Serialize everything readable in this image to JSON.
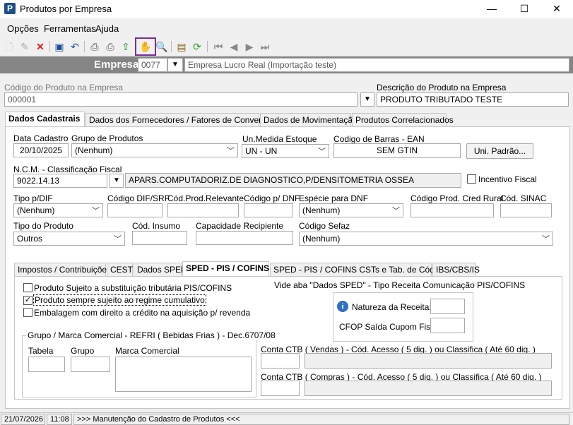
{
  "window": {
    "title": "Produtos por Empresa",
    "minimize": "—",
    "maximize": "☐",
    "close": "✕"
  },
  "menu": {
    "opcoes": "Opções",
    "ferramentas": "Ferramentas",
    "ajuda": "Ajuda"
  },
  "empresa": {
    "label": "Empresa",
    "code": "0077",
    "name": "Empresa Lucro Real (Importação teste)"
  },
  "header": {
    "codigo_label": "Código do Produto na Empresa",
    "codigo_value": "000001",
    "descricao_label": "Descrição do Produto na Empresa",
    "descricao_value": "PRODUTO TRIBUTADO TESTE"
  },
  "tabs": [
    "Dados Cadastrais",
    "Dados dos Fornecedores / Fatores de Conversão",
    "Dados de Movimentação",
    "Produtos Correlacionados"
  ],
  "form": {
    "data_cadastro_label": "Data Cadastro",
    "data_cadastro": "20/10/2025",
    "grupo_label": "Grupo de Produtos",
    "grupo": "(Nenhum)",
    "unmedida_label": "Un.Medida Estoque",
    "unmedida": "UN - UN",
    "ean_label": "Codigo de Barras - EAN",
    "ean": "SEM GTIN",
    "uni_padrao_btn": "Uni. Padrão...",
    "ncm_label": "N.C.M. -  Classificação Fiscal",
    "ncm": "9022.14.13",
    "ncm_desc": "APARS.COMPUTADORIZ.DE DIAGNOSTICO,P/DENSITOMETRIA OSSEA",
    "incentivo_label": "Incentivo Fiscal",
    "tipo_dif_label": "Tipo p/DIF",
    "tipo_dif": "(Nenhum)",
    "codigo_dif_label": "Código DIF/SRF",
    "cod_relevante_label": "Cód.Prod.Relevante",
    "codigo_dnf_label": "Código p/ DNF",
    "especie_dnf_label": "Espécie para DNF",
    "especie_dnf": "(Nenhum)",
    "cred_rural_label": "Código Prod. Cred Rural",
    "sinac_label": "Cód. SINAC",
    "tipo_produto_label": "Tipo do Produto",
    "tipo_produto": "Outros",
    "insumo_label": "Cód. Insumo",
    "capacidade_label": "Capacidade Recipiente",
    "sefaz_label": "Código Sefaz",
    "sefaz": "(Nenhum)"
  },
  "subtabs": [
    "Impostos / Contribuições",
    "CEST",
    "Dados SPED",
    "SPED - PIS / COFINS",
    "SPED - PIS / COFINS CSTs e Tab. de Códigos",
    "IBS/CBS/IS"
  ],
  "pis": {
    "chk1": "Produto Sujeito a substituição tributária PIS/COFINS",
    "chk2": "Produto sempre sujeito ao regime cumulativo",
    "chk3": "Embalagem com direito a crédito na aquisição p/ revenda",
    "vide": "Vide aba \"Dados SPED\" - Tipo Receita Comunicação PIS/COFINS",
    "natureza_label": "Natureza da Receita:",
    "cfop_label": "CFOP Saída Cupom Fiscal:",
    "grupo_title": "Grupo / Marca Comercial - REFRI ( Bebidas Frias ) - Dec.6707/08",
    "tabela_label": "Tabela",
    "grupo_label": "Grupo",
    "marca_label": "Marca Comercial",
    "ctb_vendas_label": "Conta CTB ( Vendas ) - Cód. Acesso ( 5 dig. ) ou Classifica ( Até 60 dig. )",
    "ctb_compras_label": "Conta CTB ( Compras ) - Cód. Acesso ( 5 dig. ) ou Classifica ( Até 60 dig. )"
  },
  "status": {
    "date": "21/07/2026",
    "time": "11:08",
    "message": ">>> Manutenção do Cadastro de Produtos <<<"
  }
}
